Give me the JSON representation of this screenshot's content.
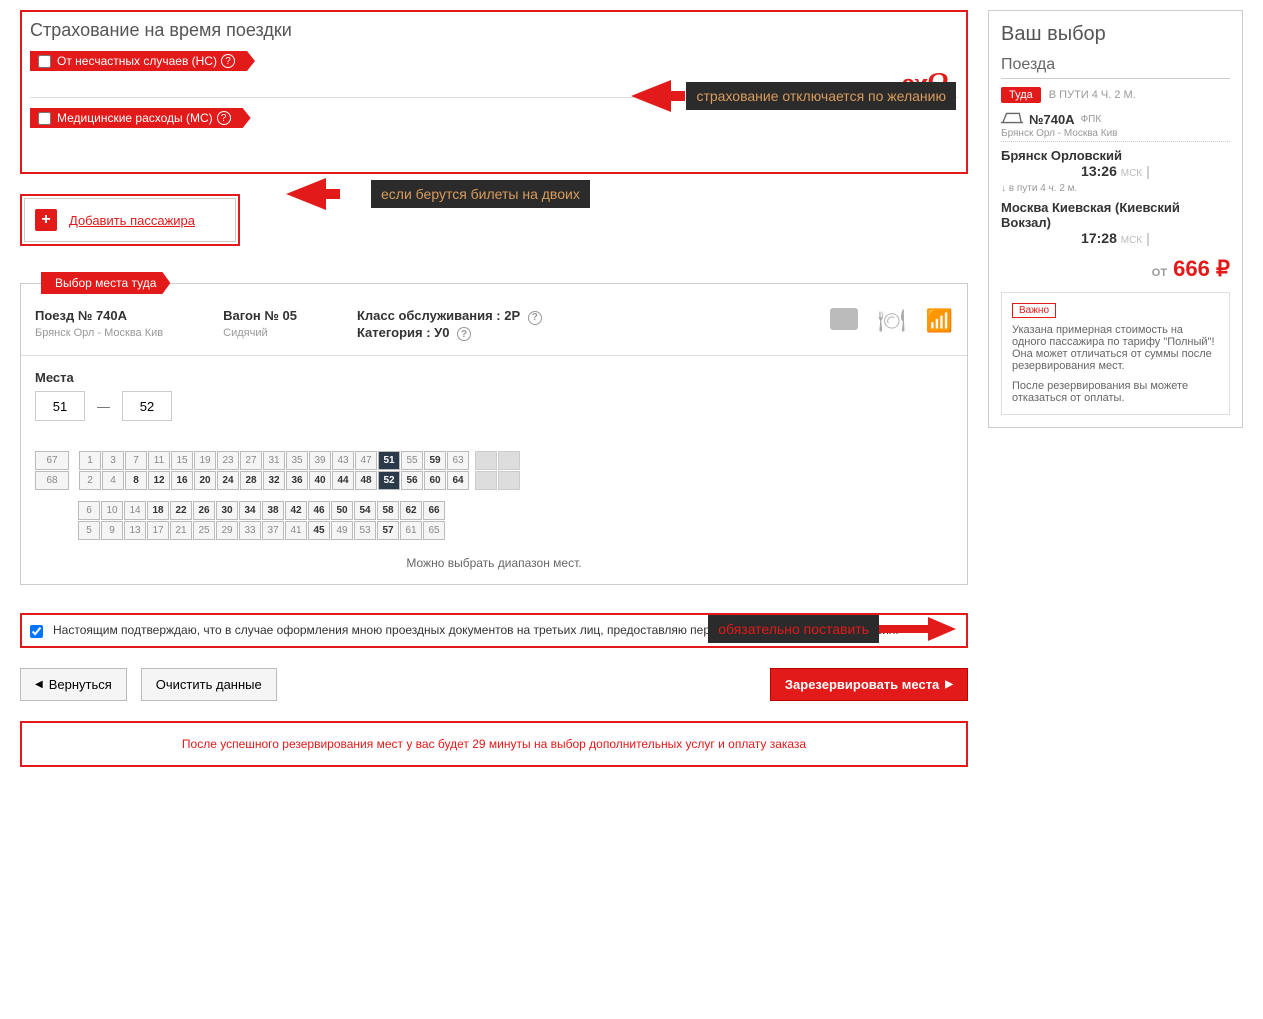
{
  "insurance": {
    "title": "Страхование на время поездки",
    "opt1": "От несчастных случаев (НС)",
    "opt2": "Медицинские расходы (МС)",
    "annot": "страхование отключается по желанию"
  },
  "add_passenger": {
    "label": "Добавить пассажира",
    "annot": "если берутся билеты на двоих"
  },
  "seat": {
    "tab": "Выбор места туда",
    "train_label": "Поезд № 740A",
    "train_route": "Брянск Орл - Москва Кив",
    "car_label": "Вагон № 05",
    "car_type": "Сидячий",
    "class_label": "Класс обслуживания : 2Р",
    "cat_label": "Категория : У0",
    "places_label": "Места",
    "place_from": "51",
    "place_to": "52",
    "range_note": "Можно выбрать диапазон мест.",
    "rows": {
      "top1": [
        {
          "n": "67",
          "b": false
        }
      ],
      "top2": [
        {
          "n": "68",
          "b": false
        }
      ],
      "r1": [
        {
          "n": "1",
          "b": false
        },
        {
          "n": "3",
          "b": false
        },
        {
          "n": "7",
          "b": false
        },
        {
          "n": "11",
          "b": false
        },
        {
          "n": "15",
          "b": false
        },
        {
          "n": "19",
          "b": false
        },
        {
          "n": "23",
          "b": false
        },
        {
          "n": "27",
          "b": false
        },
        {
          "n": "31",
          "b": false
        },
        {
          "n": "35",
          "b": false
        },
        {
          "n": "39",
          "b": false
        },
        {
          "n": "43",
          "b": false
        },
        {
          "n": "47",
          "b": false
        },
        {
          "n": "51",
          "sel": true
        },
        {
          "n": "55",
          "b": false
        },
        {
          "n": "59",
          "b": true
        },
        {
          "n": "63",
          "b": false
        }
      ],
      "r2": [
        {
          "n": "2",
          "b": false
        },
        {
          "n": "4",
          "b": false
        },
        {
          "n": "8",
          "b": true
        },
        {
          "n": "12",
          "b": true
        },
        {
          "n": "16",
          "b": true
        },
        {
          "n": "20",
          "b": true
        },
        {
          "n": "24",
          "b": true
        },
        {
          "n": "28",
          "b": true
        },
        {
          "n": "32",
          "b": true
        },
        {
          "n": "36",
          "b": true
        },
        {
          "n": "40",
          "b": true
        },
        {
          "n": "44",
          "b": true
        },
        {
          "n": "48",
          "b": true
        },
        {
          "n": "52",
          "sel": true
        },
        {
          "n": "56",
          "b": true
        },
        {
          "n": "60",
          "b": true
        },
        {
          "n": "64",
          "b": true
        }
      ],
      "r3": [
        {
          "n": "6",
          "b": false
        },
        {
          "n": "10",
          "b": false
        },
        {
          "n": "14",
          "b": false
        },
        {
          "n": "18",
          "b": true
        },
        {
          "n": "22",
          "b": true
        },
        {
          "n": "26",
          "b": true
        },
        {
          "n": "30",
          "b": true
        },
        {
          "n": "34",
          "b": true
        },
        {
          "n": "38",
          "b": true
        },
        {
          "n": "42",
          "b": true
        },
        {
          "n": "46",
          "b": true
        },
        {
          "n": "50",
          "b": true
        },
        {
          "n": "54",
          "b": true
        },
        {
          "n": "58",
          "b": true
        },
        {
          "n": "62",
          "b": true
        },
        {
          "n": "66",
          "b": true
        }
      ],
      "r4": [
        {
          "n": "5",
          "b": false
        },
        {
          "n": "9",
          "b": false
        },
        {
          "n": "13",
          "b": false
        },
        {
          "n": "17",
          "b": false
        },
        {
          "n": "21",
          "b": false
        },
        {
          "n": "25",
          "b": false
        },
        {
          "n": "29",
          "b": false
        },
        {
          "n": "33",
          "b": false
        },
        {
          "n": "37",
          "b": false
        },
        {
          "n": "41",
          "b": false
        },
        {
          "n": "45",
          "b": true
        },
        {
          "n": "49",
          "b": false
        },
        {
          "n": "53",
          "b": false
        },
        {
          "n": "57",
          "b": true
        },
        {
          "n": "61",
          "b": false
        },
        {
          "n": "65",
          "b": false
        }
      ]
    }
  },
  "consent": {
    "text": "Настоящим подтверждаю, что в случае оформления мною проездных документов на третьих лиц, предоставляю персональные данные с их согласия.",
    "annot": "обязательно поставить"
  },
  "buttons": {
    "back": "Вернуться",
    "clear": "Очистить данные",
    "reserve": "Зарезервировать места"
  },
  "bottom_note": "После успешного резервирования мест у вас будет 29 минуты на выбор дополнительных услуг и оплату заказа",
  "sidebar": {
    "title": "Ваш выбор",
    "trains": "Поезда",
    "dir_label": "Туда",
    "dir_dur": "В ПУТИ 4 Ч. 2 М.",
    "train_num": "№740А",
    "train_co": "ФПК",
    "route": "Брянск Орл - Москва Кив",
    "dep_station": "Брянск Орловский",
    "dep_time": "13:26",
    "tz": "МСК",
    "dur2": "в пути  4 ч. 2 м.",
    "arr_station": "Москва Киевская (Киевский Вокзал)",
    "arr_time": "17:28",
    "price_from": "ОТ",
    "price": "666 ₽",
    "info_badge": "Важно",
    "info1": "Указана примерная стоимость на одного пассажира по тарифу \"Полный\"! Она может отличаться от суммы после резервирования мест.",
    "info2": "После резервирования вы можете отказаться от оплаты."
  }
}
